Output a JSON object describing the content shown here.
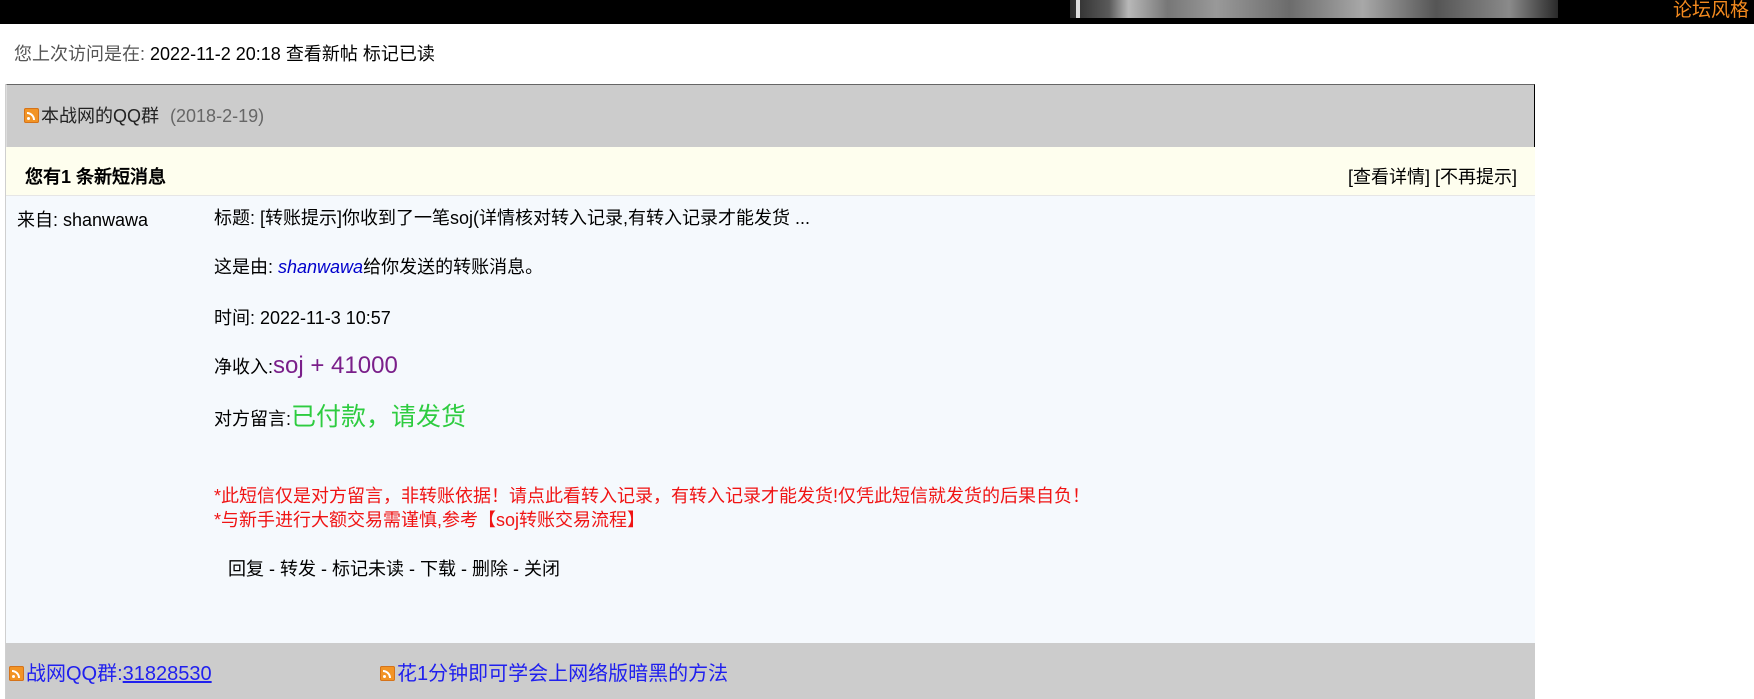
{
  "top": {
    "forum_style": "论坛风格"
  },
  "visit": {
    "label": "您上次访问是在:",
    "datetime": "2022-11-2 20:18",
    "new_posts": "查看新帖",
    "mark_read": "标记已读"
  },
  "announcement": {
    "title": "本战网的QQ群",
    "date": "(2018-2-19)"
  },
  "message_header": {
    "count_text": "您有1 条新短消息",
    "view_detail": "[查看详情]",
    "no_remind": "[不再提示]"
  },
  "message": {
    "from": "来自: shanwawa",
    "subject": "标题: [转账提示]你收到了一笔soj(详情核对转入记录,有转入记录才能发货 ...",
    "sent_by_prefix": "这是由: ",
    "sender": "shanwawa",
    "sent_by_suffix": "给你发送的转账消息。",
    "time": "时间: 2022-11-3 10:57",
    "income_label": "净收入:",
    "income_value": "soj + 41000",
    "note_label": "对方留言:",
    "note_value": "已付款，请发货",
    "warning_1_prefix": "*此短信仅是对方留言，非转账依据！请点",
    "warning_1_link": "此看转入记录",
    "warning_1_suffix": "，有转入记录才能发货!仅凭此短信就发货的后果自负！",
    "warning_2_prefix": "*与新手进行大额交易需谨慎,参考",
    "warning_2_link": "【soj转账交易流程】",
    "actions": [
      "回复",
      "转发",
      "标记未读",
      "下载",
      "删除",
      "关闭"
    ],
    "action_sep": " - "
  },
  "footer_links": [
    {
      "prefix": "战网QQ群:",
      "link": "31828530"
    },
    {
      "text": "花1分钟即可学会上网络版暗黑的方法"
    }
  ],
  "colors": {
    "income": "#7a1f8a",
    "note": "#2ecc40",
    "warning": "#f01414",
    "link": "#2020ee",
    "forum_style": "#f28a1f"
  }
}
